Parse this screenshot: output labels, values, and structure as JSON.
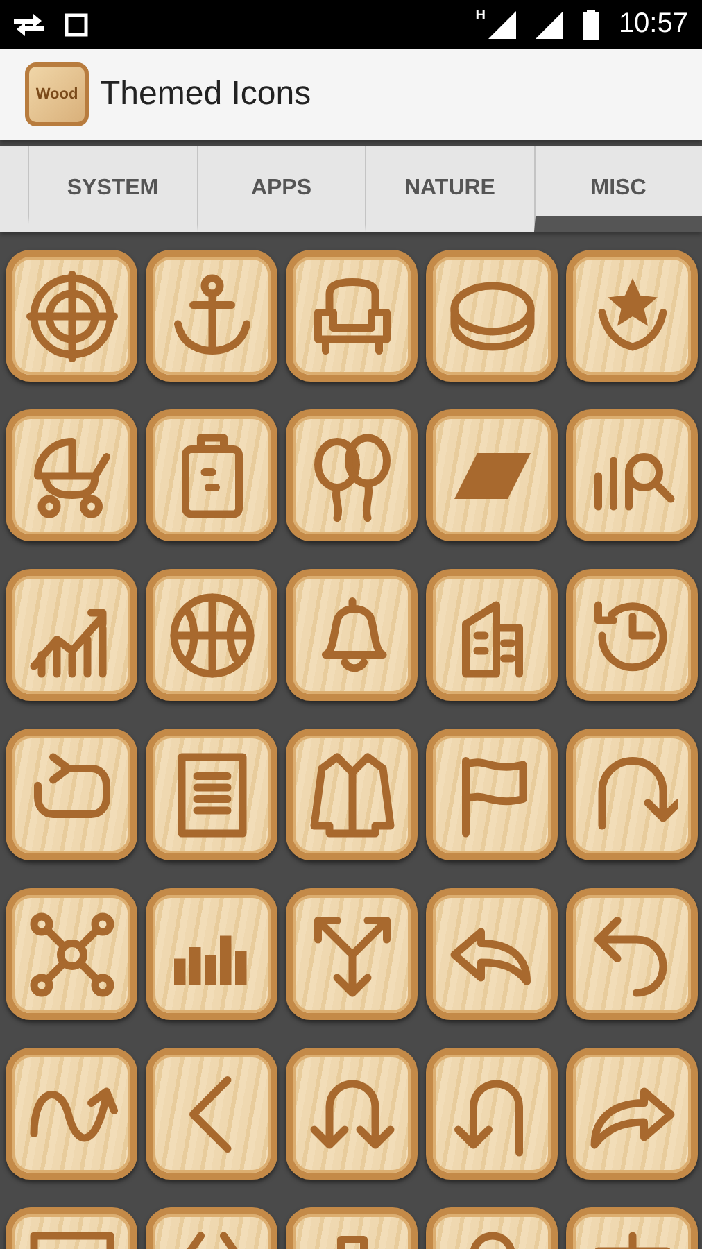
{
  "status_bar": {
    "network_type": "H",
    "time": "10:57"
  },
  "app_bar": {
    "logo_text": "Wood",
    "title": "Themed Icons"
  },
  "tabs": [
    {
      "label": "SYSTEM",
      "selected": false
    },
    {
      "label": "APPS",
      "selected": false
    },
    {
      "label": "NATURE",
      "selected": false
    },
    {
      "label": "MISC",
      "selected": true
    }
  ]
}
